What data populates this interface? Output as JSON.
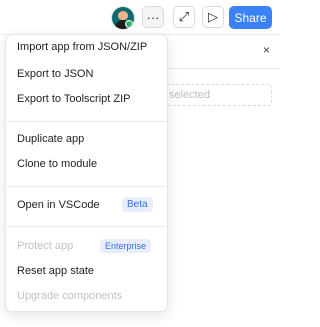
{
  "toolbar": {
    "more_glyph": "···",
    "expand_glyph": "⤢",
    "play_glyph": "▷",
    "share_label": "Share",
    "avatar_icon": "user-avatar-icon"
  },
  "background_panel": {
    "close_glyph": "×",
    "field_placeholder": "selected"
  },
  "menu": {
    "import_json": "Import app from JSON/ZIP",
    "export_json": "Export to JSON",
    "export_zip": "Export to Toolscript ZIP",
    "duplicate": "Duplicate app",
    "clone_module": "Clone to module",
    "open_vscode": "Open in VSCode",
    "vscode_badge": "Beta",
    "protect_app": "Protect app",
    "protect_badge": "Enterprise",
    "reset_state": "Reset app state",
    "upgrade_components": "Upgrade components"
  },
  "colors": {
    "accent": "#3b82f6",
    "badge_bg": "#e8eefc",
    "badge_text": "#3a6fe0",
    "disabled_text": "#bfc2c7"
  }
}
